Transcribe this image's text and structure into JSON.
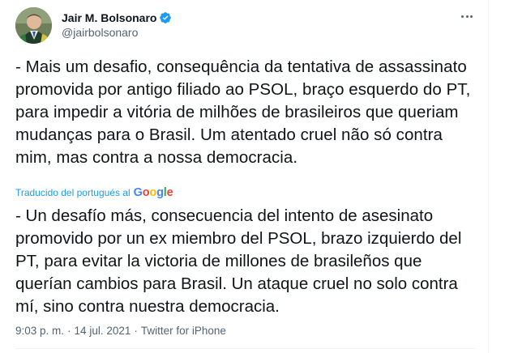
{
  "author": {
    "display_name": "Jair M. Bolsonaro",
    "handle": "@jairbolsonaro",
    "verified": true,
    "avatar_icon": "profile-photo"
  },
  "more_icon": "more-horizontal-icon",
  "tweet": {
    "text": "- Mais um desafio, consequência da tentativa de assassinato promovida por antigo filiado ao PSOL, braço esquerdo do PT, para impedir a vitória de milhões de brasileiros que queriam mudanças para o Brasil. Um atentado cruel não só contra mim, mas contra a nossa democracia.",
    "translated_by_label": "Traducido del portugués al",
    "translation_provider": "Google",
    "translation": "- Un desafío más, consecuencia del intento de asesinato promovido por un ex miembro del PSOL, brazo izquierdo del PT, para evitar la victoria de millones de brasileños que querían cambios para Brasil. Un ataque cruel no solo contra mí, sino contra nuestra democracia."
  },
  "meta": {
    "time": "9:03 p. m.",
    "separator": "·",
    "date": "14 jul. 2021",
    "source": "Twitter for iPhone"
  },
  "colors": {
    "link": "#1d9bf0",
    "secondary_text": "#536471",
    "verified_badge": "#1d9bf0"
  }
}
